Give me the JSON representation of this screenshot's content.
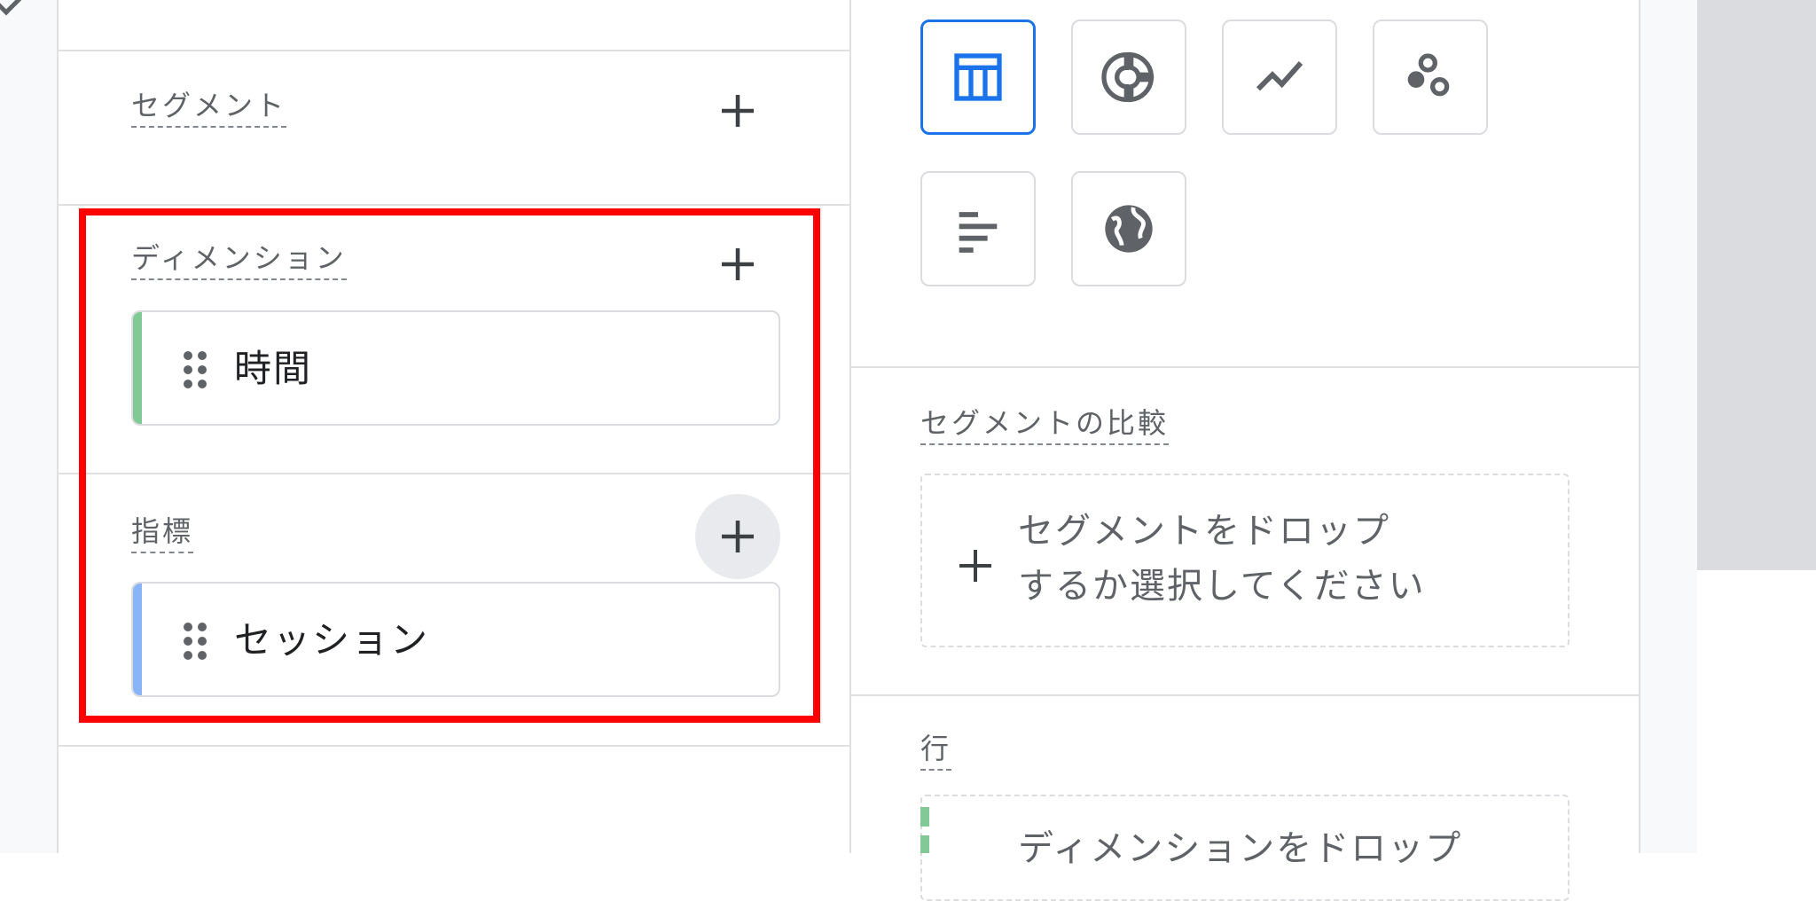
{
  "variables": {
    "segments": {
      "label": "セグメント"
    },
    "dimensions": {
      "label": "ディメンション",
      "items": [
        {
          "label": "時間",
          "accent": "#81c995"
        }
      ]
    },
    "metrics": {
      "label": "指標",
      "items": [
        {
          "label": "セッション",
          "accent": "#8ab4f8"
        }
      ]
    }
  },
  "settings": {
    "visualizations": [
      {
        "name": "table",
        "icon": "table-icon",
        "selected": true
      },
      {
        "name": "donut",
        "icon": "donut-chart-icon",
        "selected": false
      },
      {
        "name": "line",
        "icon": "line-chart-icon",
        "selected": false
      },
      {
        "name": "scatter",
        "icon": "scatter-plot-icon",
        "selected": false
      },
      {
        "name": "bar",
        "icon": "bar-chart-icon",
        "selected": false
      },
      {
        "name": "geo",
        "icon": "globe-icon",
        "selected": false
      }
    ],
    "segment_comparison": {
      "label": "セグメントの比較",
      "drop_text": "セグメントをドロップするか選択してください"
    },
    "rows": {
      "label": "行",
      "drop_text": "ディメンションをドロップ"
    }
  },
  "colors": {
    "accent_blue": "#1a73e8",
    "highlight_red": "#ff0000",
    "dimension_green": "#81c995",
    "metric_blue": "#8ab4f8"
  }
}
